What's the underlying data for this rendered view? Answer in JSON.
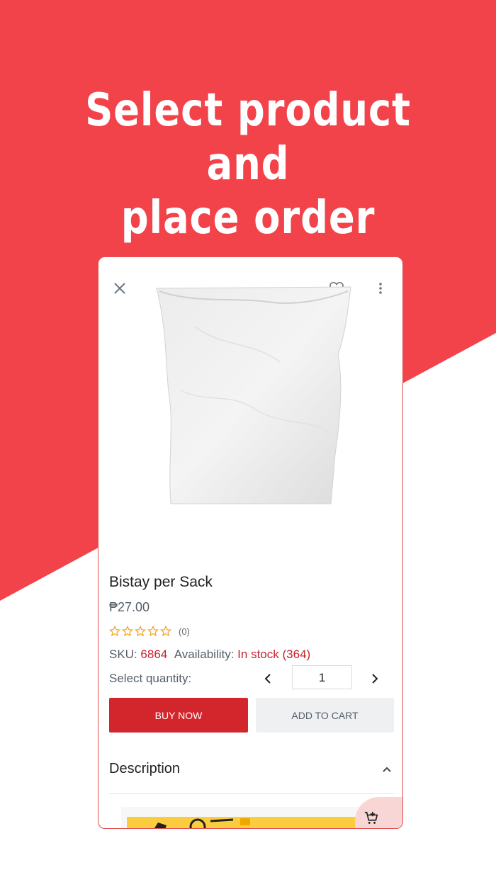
{
  "headline": {
    "line1": "Select product and",
    "line2": "place order"
  },
  "colors": {
    "brand_red": "#f2424a",
    "buy_red": "#d2262c",
    "star_orange": "#f0a020"
  },
  "icons": {
    "close": "close-icon",
    "favorite": "heart-outline-icon",
    "more": "more-vertical-icon",
    "qty_prev": "chevron-left-icon",
    "qty_next": "chevron-right-icon",
    "description_toggle": "chevron-up-icon",
    "cart": "add-shopping-cart-icon"
  },
  "product": {
    "name": "Bistay per Sack",
    "price": "₱27.00",
    "rating": {
      "value": 0,
      "max": 5,
      "count": "(0)"
    },
    "sku_label": "SKU:",
    "sku": "6864",
    "availability_label": "Availability:",
    "availability": "In stock",
    "stock_count": "(364)"
  },
  "quantity": {
    "label": "Select quantity:",
    "value": "1"
  },
  "actions": {
    "buy_now": "BUY NOW",
    "add_to_cart": "ADD TO CART"
  },
  "description": {
    "title": "Description"
  }
}
